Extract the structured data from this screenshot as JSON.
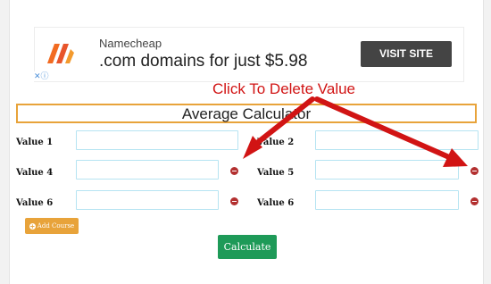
{
  "ad": {
    "brand": "Namecheap",
    "headline": ".com domains for just $5.98",
    "cta": "VISIT SITE",
    "choices_glyph": "✕ⓘ"
  },
  "calculator": {
    "title": "Average Calculator",
    "rows": [
      {
        "left_label": "Value 1",
        "left_value": "",
        "right_label": "Value 2",
        "right_value": ""
      },
      {
        "left_label": "Value 4",
        "left_value": "",
        "right_label": "Value 5",
        "right_value": ""
      },
      {
        "left_label": "Value 6",
        "left_value": "",
        "right_label": "Value 6",
        "right_value": ""
      }
    ],
    "add_button": "Add Course",
    "calculate_button": "Calculate"
  },
  "annotation": {
    "text": "Click To Delete Value",
    "color": "#d11414"
  },
  "colors": {
    "accent_orange": "#e8a33a",
    "calculate_green": "#1e9a58",
    "remove_red": "#b33030",
    "input_border": "#b6e4f2"
  }
}
